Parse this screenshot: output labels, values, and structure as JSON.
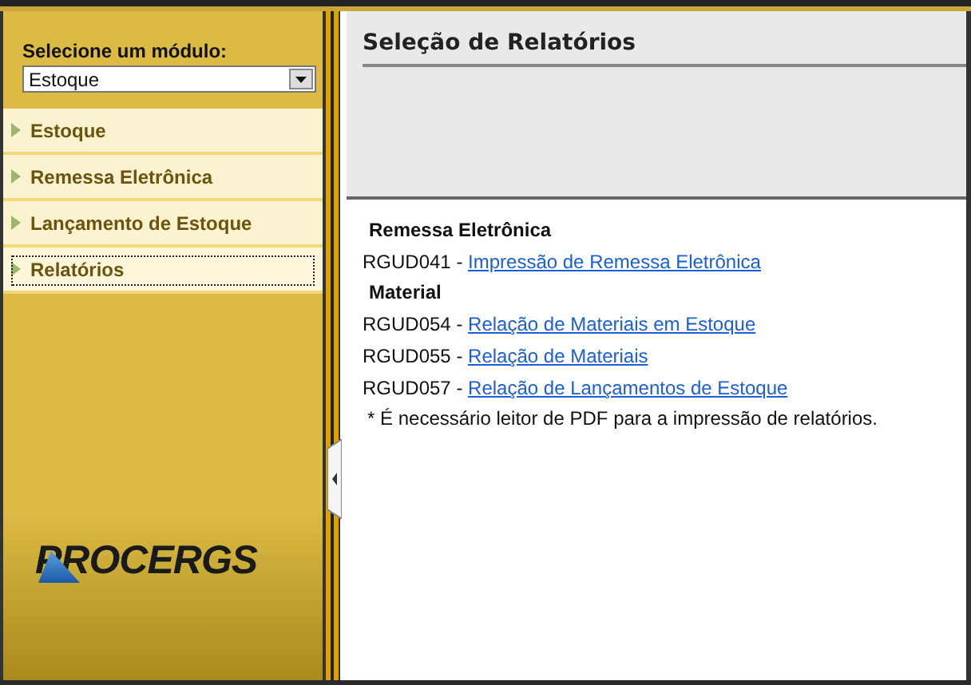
{
  "sidebar": {
    "module_label": "Selecione um módulo:",
    "module_select": {
      "value": "Estoque"
    },
    "items": [
      {
        "label": "Estoque",
        "selected": false
      },
      {
        "label": "Remessa Eletrônica",
        "selected": false
      },
      {
        "label": "Lançamento de Estoque",
        "selected": false
      },
      {
        "label": "Relatórios",
        "selected": true
      }
    ],
    "logo": "PROCERGS"
  },
  "content": {
    "title": "Seleção de Relatórios",
    "entries": [
      {
        "kind": "heading",
        "text": "Remessa Eletrônica"
      },
      {
        "kind": "report",
        "code": "RGUD041 -",
        "link": "Impressão de Remessa Eletrônica"
      },
      {
        "kind": "heading",
        "text": "Material"
      },
      {
        "kind": "report",
        "code": "RGUD054 -",
        "link": "Relação de Materiais em Estoque"
      },
      {
        "kind": "report",
        "code": "RGUD055 -",
        "link": "Relação de Materiais"
      },
      {
        "kind": "report",
        "code": "RGUD057 -",
        "link": "Relação de Lançamentos de Estoque"
      }
    ],
    "note": "* É necessário leitor de PDF para a impressão de relatórios."
  }
}
